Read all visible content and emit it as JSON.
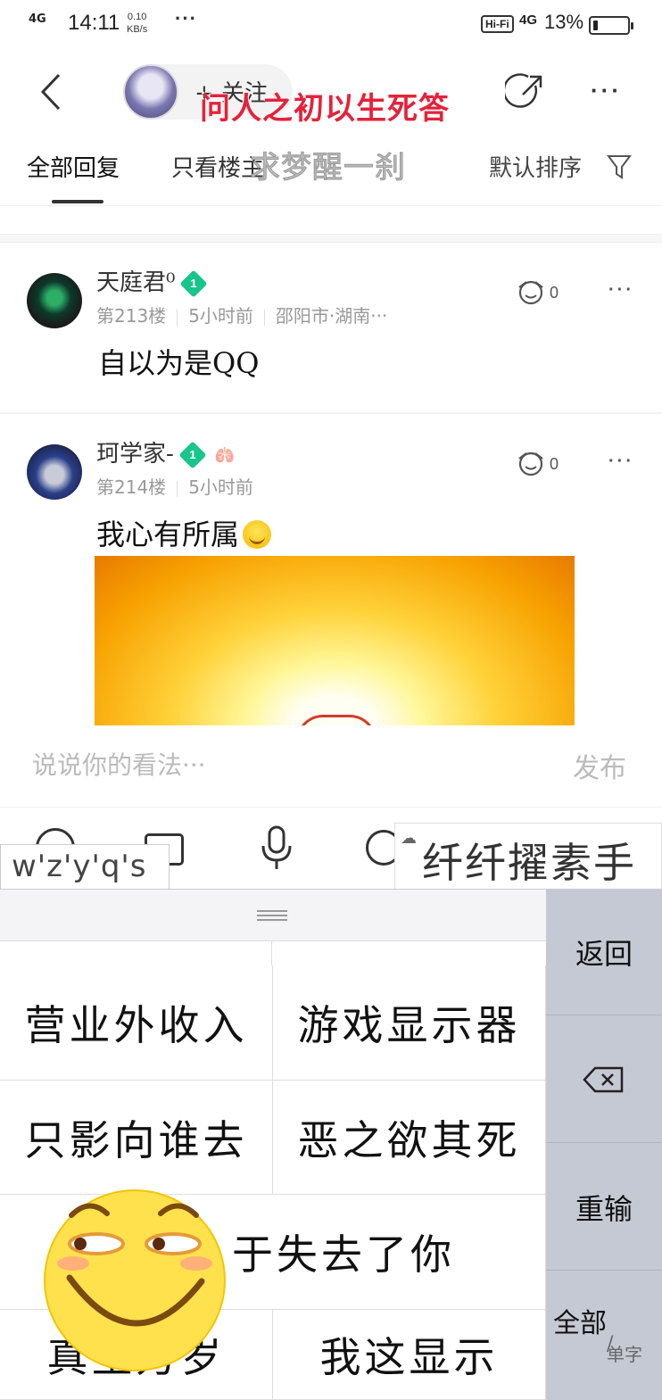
{
  "status_bar": {
    "network": "4G",
    "time": "14:11",
    "speed_value": "0.10",
    "speed_unit": "KB/s",
    "more": "···",
    "hifi": "Hi-Fi",
    "signal": "4G",
    "battery_percent": "13%"
  },
  "header": {
    "follow_label": "+ 关注",
    "overlay_title": "问人之初以生死答",
    "overlay_subtitle": "求梦醒一刹",
    "more": "···"
  },
  "tabs": {
    "all_replies": "全部回复",
    "owner_only": "只看楼主",
    "sort": "默认排序"
  },
  "posts": [
    {
      "username": "天庭君⁰",
      "level": "1",
      "floor": "第213楼",
      "time": "5小时前",
      "location": "邵阳市·湖南···",
      "likes": "0",
      "content": "自以为是QQ"
    },
    {
      "username": "珂学家-",
      "level": "1",
      "floor": "第214楼",
      "time": "5小时前",
      "likes": "0",
      "content": "我心有所属"
    }
  ],
  "comment": {
    "placeholder": "说说你的看法···",
    "publish": "发布"
  },
  "ime": {
    "pinyin": "w'z'y'q's",
    "preview": "纤纤擢素手",
    "candidates": [
      "营业外收入",
      "游戏显示器",
      "只影向谁去",
      "恶之欲其死",
      "于失去了你",
      "真主万岁",
      "我这显示"
    ],
    "side": {
      "back": "返回",
      "retype": "重输",
      "all": "全部",
      "single": "单字"
    }
  },
  "colors": {
    "accent_red": "#e5223a",
    "level_badge": "#18c58a",
    "keyboard_side": "#c5c9d4"
  },
  "icons": [
    "back-icon",
    "share-icon",
    "filter-icon",
    "like-icon",
    "emoji-icon",
    "image-icon",
    "mic-icon",
    "at-icon",
    "backspace-icon"
  ]
}
